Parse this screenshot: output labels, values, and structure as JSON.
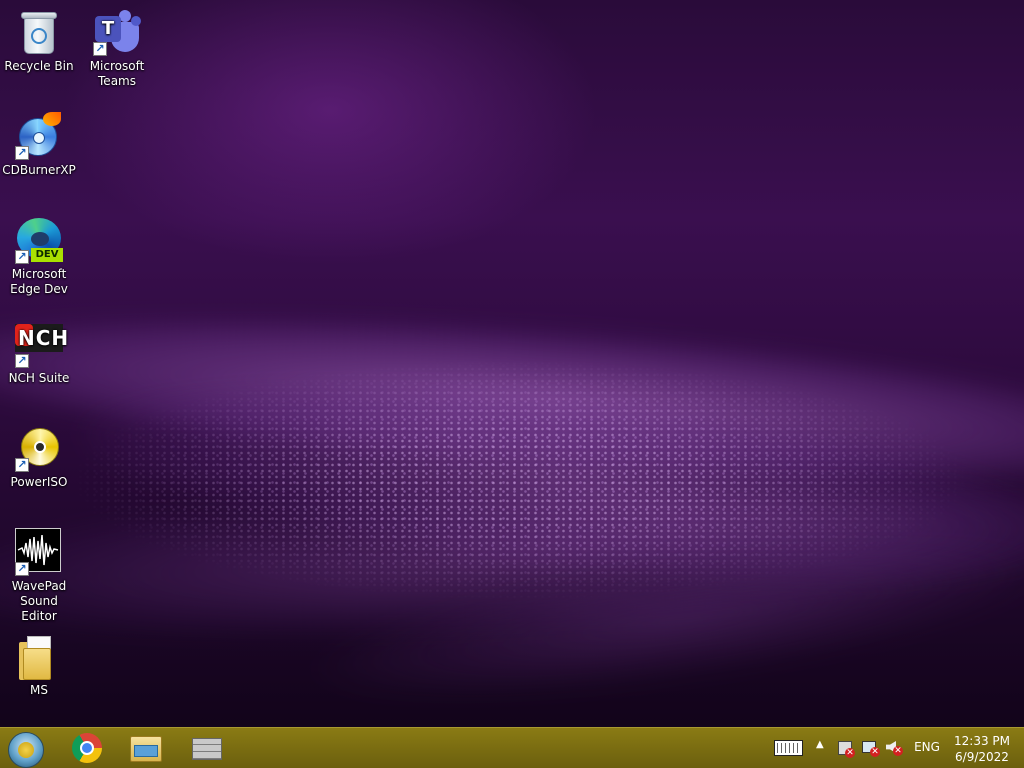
{
  "desktop": {
    "icons": [
      {
        "label": "Recycle Bin"
      },
      {
        "label": "Microsoft\nTeams"
      },
      {
        "label": "CDBurnerXP"
      },
      {
        "label": "Microsoft\nEdge Dev"
      },
      {
        "label": "NCH Suite"
      },
      {
        "label": "PowerISO"
      },
      {
        "label": "WavePad\nSound Editor"
      },
      {
        "label": "MS"
      }
    ],
    "edge_badge": "DEV",
    "teams_letter": "T",
    "nch_letters": "NCH"
  },
  "taskbar": {
    "pinned": [
      {
        "icon": "start-orb-icon"
      },
      {
        "icon": "chrome-icon"
      },
      {
        "icon": "file-explorer-icon"
      },
      {
        "icon": "firewall-icon"
      }
    ],
    "tray": {
      "language": "ENG",
      "time": "12:33 PM",
      "date": "6/9/2022"
    }
  }
}
